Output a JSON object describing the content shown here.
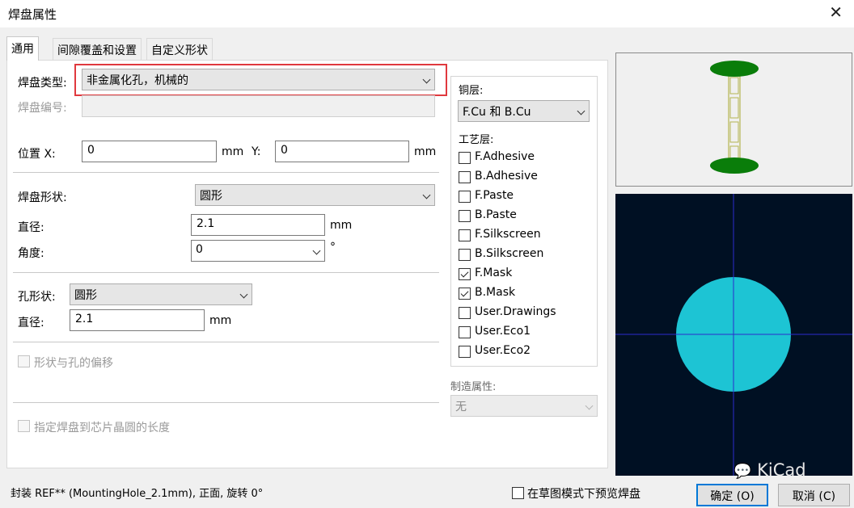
{
  "window": {
    "title": "焊盘属性",
    "close_glyph": "✕"
  },
  "tabs": [
    {
      "label": "通用",
      "active": true
    },
    {
      "label": "间隙覆盖和设置",
      "active": false
    },
    {
      "label": "自定义形状",
      "active": false
    }
  ],
  "general": {
    "pad_type_label": "焊盘类型:",
    "pad_type_value": "非金属化孔，机械的",
    "pad_number_label": "焊盘编号:",
    "pad_number_value": "",
    "position_x_label": "位置 X:",
    "position_x_value": "0",
    "position_x_unit": "mm",
    "position_y_label": "Y:",
    "position_y_value": "0",
    "position_y_unit": "mm",
    "pad_shape_label": "焊盘形状:",
    "pad_shape_value": "圆形",
    "diameter_label": "直径:",
    "diameter_value": "2.1",
    "diameter_unit": "mm",
    "angle_label": "角度:",
    "angle_value": "0",
    "angle_unit": "°",
    "hole_shape_label": "孔形状:",
    "hole_shape_value": "圆形",
    "hole_diameter_label": "直径:",
    "hole_diameter_value": "2.1",
    "hole_diameter_unit": "mm",
    "offset_checkbox_label": "形状与孔的偏移",
    "die_length_checkbox_label": "指定焊盘到芯片晶圆的长度"
  },
  "layers": {
    "copper_label": "铜层:",
    "copper_value": "F.Cu 和 B.Cu",
    "tech_label": "工艺层:",
    "items": [
      {
        "label": "F.Adhesive",
        "checked": false
      },
      {
        "label": "B.Adhesive",
        "checked": false
      },
      {
        "label": "F.Paste",
        "checked": false
      },
      {
        "label": "B.Paste",
        "checked": false
      },
      {
        "label": "F.Silkscreen",
        "checked": false
      },
      {
        "label": "B.Silkscreen",
        "checked": false
      },
      {
        "label": "F.Mask",
        "checked": true
      },
      {
        "label": "B.Mask",
        "checked": true
      },
      {
        "label": "User.Drawings",
        "checked": false
      },
      {
        "label": "User.Eco1",
        "checked": false
      },
      {
        "label": "User.Eco2",
        "checked": false
      }
    ],
    "fab_label": "制造属性:",
    "fab_value": "无"
  },
  "footer": {
    "status": "封装 REF** (MountingHole_2.1mm), 正面, 旋转 0°",
    "sketch_preview_label": "在草图模式下预览焊盘",
    "ok_label": "确定 (O)",
    "cancel_label": "取消 (C)"
  },
  "watermark": "KiCad",
  "colors": {
    "highlight": "#e0393e",
    "pad_fill": "#1dc4d4",
    "preview_bg": "#001023",
    "crosshair": "#2b2bcc",
    "side_pad": "#0a7d0a",
    "hole_outline": "#b4b450"
  }
}
